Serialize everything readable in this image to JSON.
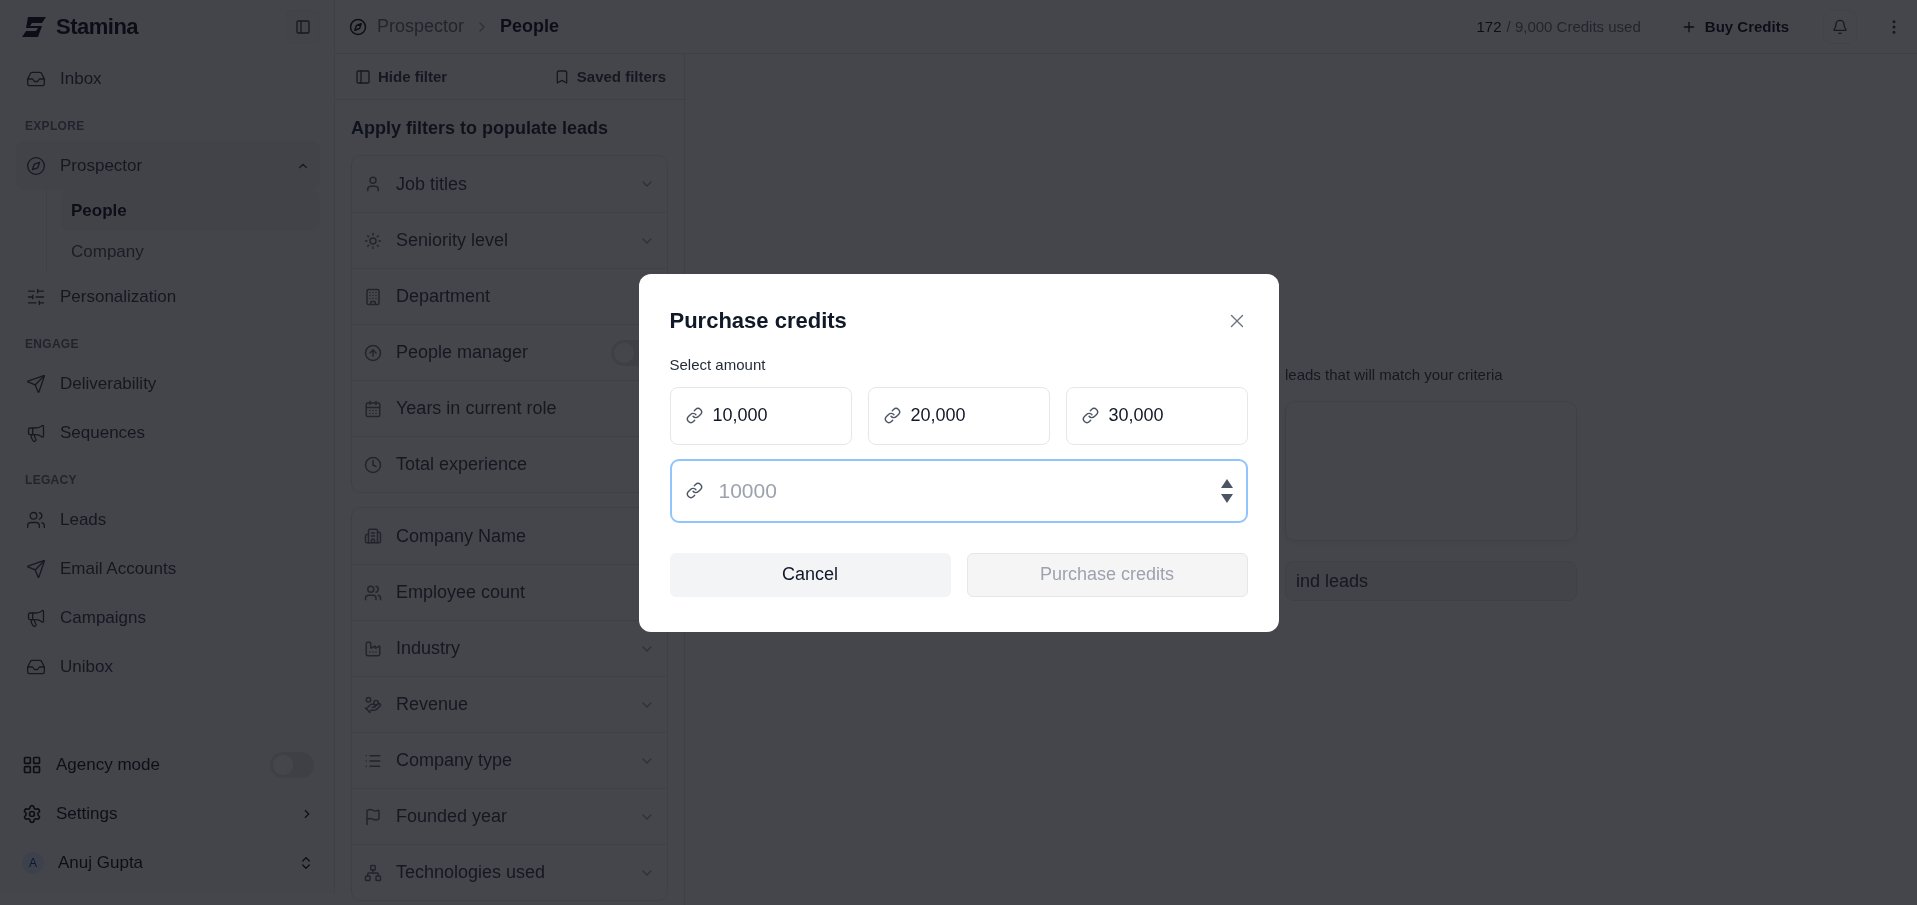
{
  "topbar": {
    "breadcrumb": [
      "Prospector",
      "People"
    ],
    "credits_used": "172",
    "credits_rest": "/ 9,000 Credits used",
    "buy_button": "Buy Credits"
  },
  "sidebar": {
    "brand": "Stamina",
    "sections": [
      {
        "items": [
          {
            "label": "Inbox",
            "selected": false
          }
        ]
      },
      {
        "heading": "EXPLORE",
        "items": [
          {
            "label": "Prospector",
            "selected": false,
            "expanded": true,
            "children": [
              {
                "label": "People",
                "selected": true
              },
              {
                "label": "Company",
                "selected": false
              }
            ]
          },
          {
            "label": "Personalization",
            "selected": false
          }
        ]
      },
      {
        "heading": "ENGAGE",
        "items": [
          {
            "label": "Deliverability",
            "selected": false
          },
          {
            "label": "Sequences",
            "selected": false
          }
        ]
      },
      {
        "heading": "LEGACY",
        "items": [
          {
            "label": "Leads",
            "selected": false
          },
          {
            "label": "Email Accounts",
            "selected": false
          },
          {
            "label": "Campaigns",
            "selected": false
          },
          {
            "label": "Unibox",
            "selected": false
          }
        ]
      }
    ],
    "agency": {
      "label": "Agency mode",
      "on": false
    },
    "settings": "Settings",
    "user": {
      "initial": "A",
      "name": "Anuj Gupta"
    }
  },
  "filters": {
    "hide": "Hide filter",
    "saved": "Saved filters",
    "heading": "Apply filters to populate leads",
    "groups": [
      [
        {
          "kind": "dropdown",
          "label": "Job titles"
        },
        {
          "kind": "dropdown",
          "label": "Seniority level"
        },
        {
          "kind": "dropdown",
          "label": "Department"
        },
        {
          "kind": "toggle",
          "label": "People manager",
          "on": false
        },
        {
          "kind": "dropdown",
          "label": "Years in current role"
        },
        {
          "kind": "dropdown",
          "label": "Total experience"
        }
      ],
      [
        {
          "kind": "dropdown",
          "label": "Company Name"
        },
        {
          "kind": "dropdown",
          "label": "Employee count"
        },
        {
          "kind": "dropdown",
          "label": "Industry"
        },
        {
          "kind": "dropdown",
          "label": "Revenue"
        },
        {
          "kind": "dropdown",
          "label": "Company type"
        },
        {
          "kind": "dropdown",
          "label": "Founded year"
        },
        {
          "kind": "dropdown",
          "label": "Technologies used"
        }
      ]
    ]
  },
  "main": {
    "hint": "leads that will match your criteria",
    "find_button": "ind leads"
  },
  "modal": {
    "title": "Purchase credits",
    "subtitle": "Select amount",
    "options": [
      {
        "label": "10,000",
        "selected": false
      },
      {
        "label": "20,000",
        "selected": false
      },
      {
        "label": "30,000",
        "selected": false
      }
    ],
    "custom": {
      "placeholder": "10000",
      "focused": true
    },
    "cancel": "Cancel",
    "confirm": {
      "label": "Purchase credits",
      "disabled": true
    }
  }
}
